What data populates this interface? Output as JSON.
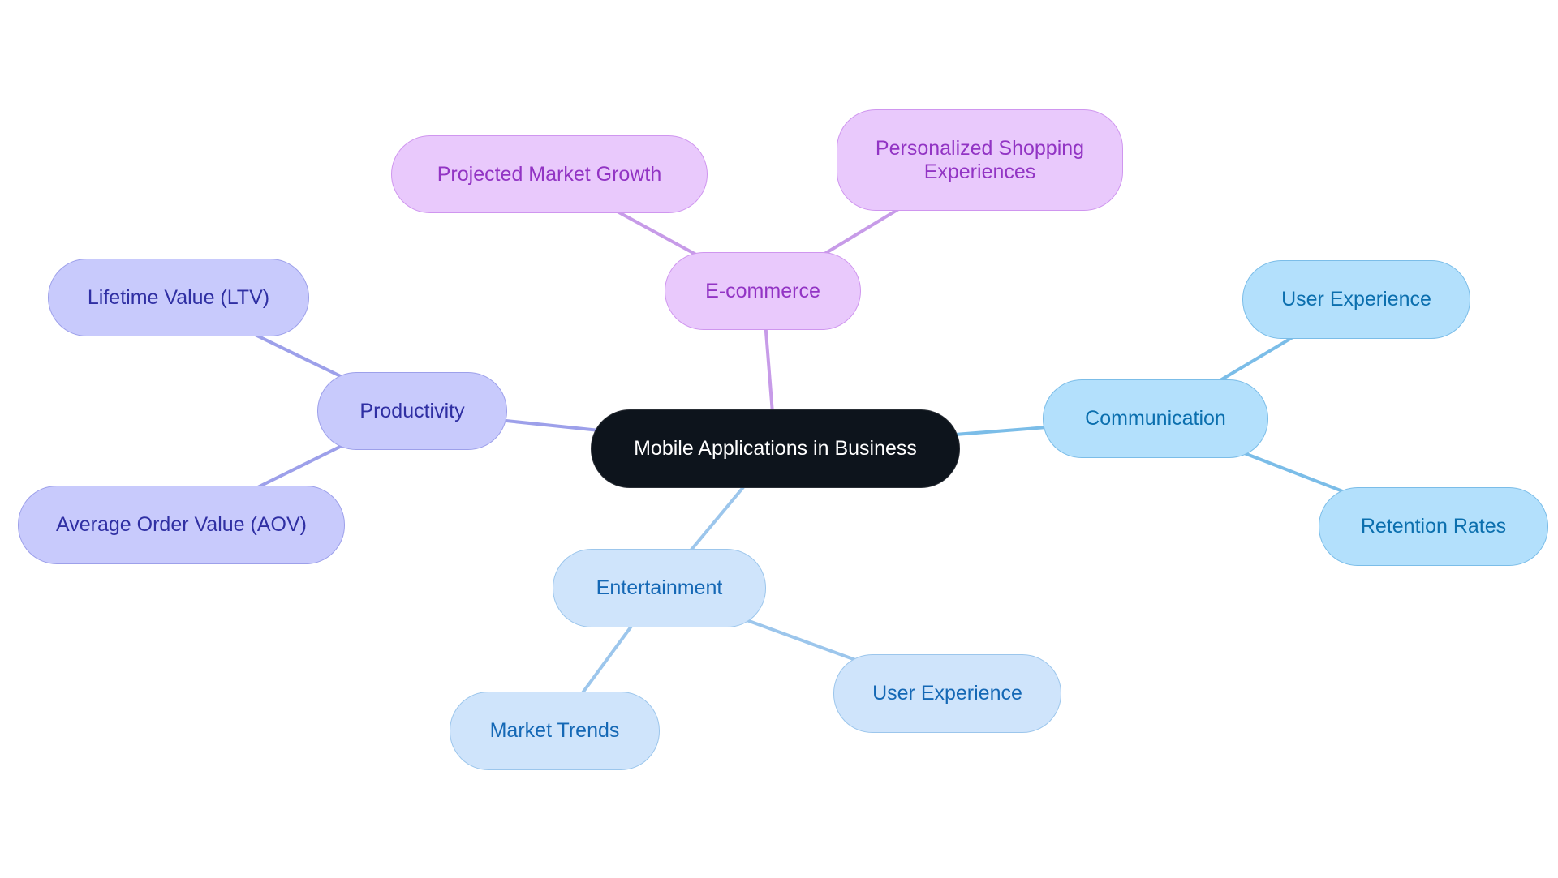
{
  "title": "Mobile Applications in Business",
  "colors": {
    "root": "#0d141c",
    "ecommerce": "#c79be8",
    "productivity": "#9da0ea",
    "communication": "#7bbde8",
    "entertainment": "#9cc6ec"
  },
  "nodes": {
    "root": {
      "label": "Mobile Applications in Business"
    },
    "ecommerce": {
      "label": "E-commerce"
    },
    "projected_market_growth": {
      "label": "Projected Market Growth"
    },
    "personalized_shopping": {
      "label": "Personalized Shopping\nExperiences"
    },
    "productivity": {
      "label": "Productivity"
    },
    "ltv": {
      "label": "Lifetime Value (LTV)"
    },
    "aov": {
      "label": "Average Order Value (AOV)"
    },
    "communication": {
      "label": "Communication"
    },
    "comm_user_experience": {
      "label": "User Experience"
    },
    "retention_rates": {
      "label": "Retention Rates"
    },
    "entertainment": {
      "label": "Entertainment"
    },
    "market_trends": {
      "label": "Market Trends"
    },
    "ent_user_experience": {
      "label": "User Experience"
    }
  },
  "edges": [
    {
      "from": "root",
      "to": "ecommerce",
      "color": "#c79be8"
    },
    {
      "from": "ecommerce",
      "to": "projected_market_growth",
      "color": "#c79be8"
    },
    {
      "from": "ecommerce",
      "to": "personalized_shopping",
      "color": "#c79be8"
    },
    {
      "from": "root",
      "to": "productivity",
      "color": "#9da0ea"
    },
    {
      "from": "productivity",
      "to": "ltv",
      "color": "#9da0ea"
    },
    {
      "from": "productivity",
      "to": "aov",
      "color": "#9da0ea"
    },
    {
      "from": "root",
      "to": "communication",
      "color": "#7bbde8"
    },
    {
      "from": "communication",
      "to": "comm_user_experience",
      "color": "#7bbde8"
    },
    {
      "from": "communication",
      "to": "retention_rates",
      "color": "#7bbde8"
    },
    {
      "from": "root",
      "to": "entertainment",
      "color": "#9cc6ec"
    },
    {
      "from": "entertainment",
      "to": "market_trends",
      "color": "#9cc6ec"
    },
    {
      "from": "entertainment",
      "to": "ent_user_experience",
      "color": "#9cc6ec"
    }
  ]
}
